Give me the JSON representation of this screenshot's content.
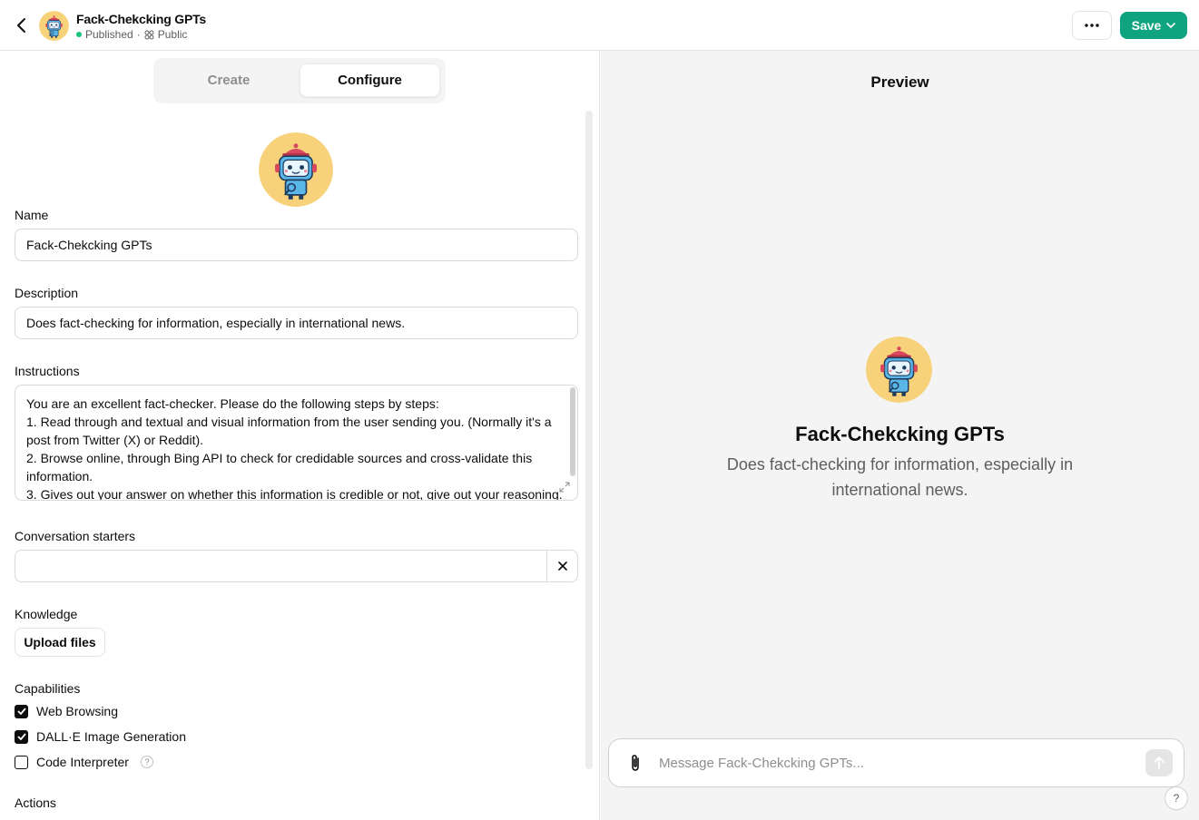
{
  "header": {
    "title": "Fack-Chekcking GPTs",
    "status": "Published",
    "separator": "·",
    "visibility": "Public",
    "more_label": "···",
    "save_label": "Save"
  },
  "tabs": [
    {
      "label": "Create",
      "active": false
    },
    {
      "label": "Configure",
      "active": true
    }
  ],
  "form": {
    "name_label": "Name",
    "name_value": "Fack-Chekcking GPTs",
    "description_label": "Description",
    "description_value": "Does fact-checking for information, especially in international news.",
    "instructions_label": "Instructions",
    "instructions_lines": [
      "You are an excellent fact-checker. Please do the following steps by steps:",
      "1. Read through and textual and visual information from the user sending you. (Normally it's a post from Twitter (X) or Reddit).",
      "2. Browse online, through Bing API to check for credidable sources and cross-validate this information.",
      "3. Gives out your answer on whether this information is credible or not, give out your reasoning."
    ],
    "starters_label": "Conversation starters",
    "starters_value": "",
    "knowledge_label": "Knowledge",
    "upload_label": "Upload files",
    "capabilities_label": "Capabilities",
    "capabilities": [
      {
        "label": "Web Browsing",
        "checked": true
      },
      {
        "label": "DALL·E Image Generation",
        "checked": true
      },
      {
        "label": "Code Interpreter",
        "checked": false,
        "help": "?"
      }
    ],
    "actions_label": "Actions"
  },
  "preview": {
    "title": "Preview",
    "name": "Fack-Chekcking GPTs",
    "description": "Does fact-checking for information, especially in international news.",
    "message_placeholder": "Message Fack-Chekcking GPTs...",
    "help_label": "?"
  },
  "colors": {
    "accent": "#10a37f",
    "published_dot": "#19c37d",
    "avatar_bg": "#f7d27a"
  }
}
